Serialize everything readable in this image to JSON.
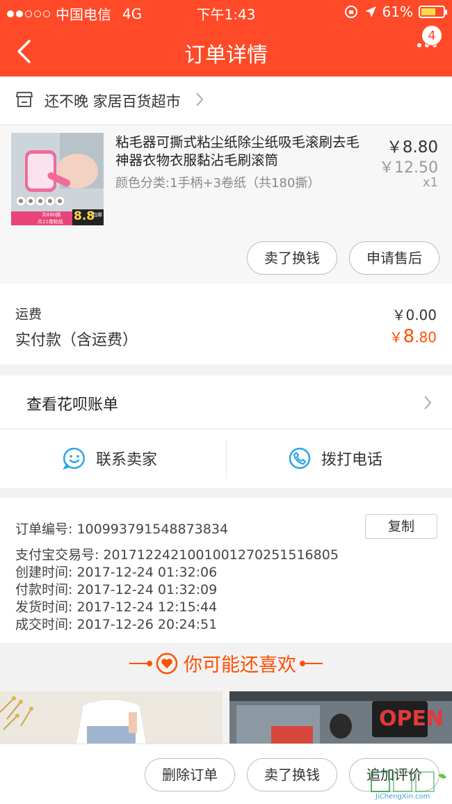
{
  "status_bar": {
    "carrier": "中国电信",
    "network": "4G",
    "time": "下午1:43",
    "battery": "61%"
  },
  "nav": {
    "title": "订单详情",
    "badge_count": "4"
  },
  "shop": {
    "name": "还不晚 家居百货超市"
  },
  "product": {
    "name": "粘毛器可撕式粘尘纸除尘纸吸毛滚刷去毛神器衣物衣服黏沾毛刷滚筒",
    "sku": "颜色分类:1手柄+3卷纸（共180撕）",
    "price": "￥8.80",
    "original_price": "￥12.50",
    "quantity": "x1",
    "thumb_tag1": "共680撕",
    "thumb_tag2": "共11卷粘纸",
    "thumb_price": "8.8",
    "thumb_price_suffix": "包邮",
    "buttons": {
      "sell": "卖了换钱",
      "after_sale": "申请售后"
    }
  },
  "fees": {
    "shipping_label": "运费",
    "shipping_value": "￥0.00",
    "total_label": "实付款（含运费）",
    "total_symbol": "￥",
    "total_int": "8",
    "total_dec": ".80"
  },
  "bill": {
    "label": "查看花呗账单"
  },
  "contact": {
    "seller": "联系卖家",
    "phone": "拨打电话"
  },
  "order_info": {
    "order_no": "订单编号:  100993791548873834",
    "copy": "复制",
    "alipay_no": "支付宝交易号:  2017122421001001270251516805",
    "created": "创建时间:  2017-12-24 01:32:06",
    "paid": "付款时间:  2017-12-24 01:32:09",
    "shipped": "发货时间:  2017-12-24 12:15:44",
    "completed": "成交时间:  2017-12-26 20:24:51"
  },
  "recommend": {
    "title": "你可能还喜欢",
    "sign_text": "OPEN"
  },
  "bottom_bar": {
    "delete": "删除订单",
    "sell": "卖了换钱",
    "review": "追加评价"
  },
  "watermark": {
    "text": "JiChengXin.com"
  },
  "colors": {
    "brand": "#fe4a28",
    "price_accent": "#ff5000"
  }
}
